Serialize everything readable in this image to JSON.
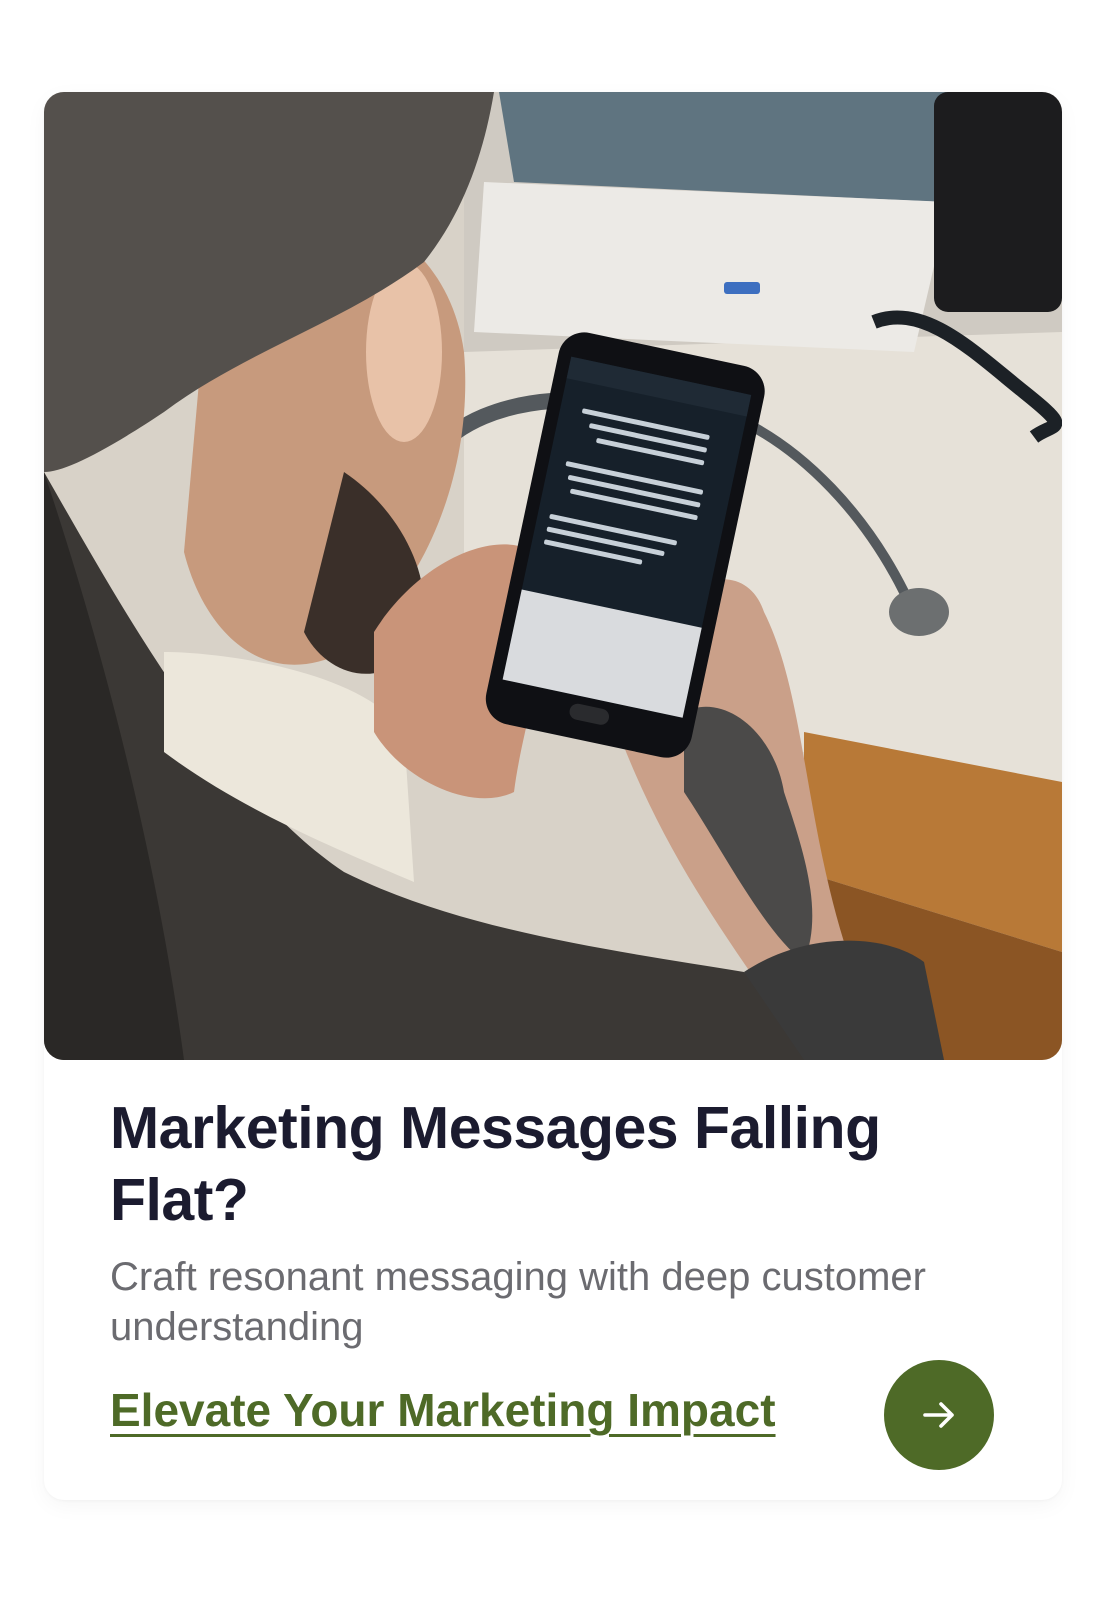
{
  "card": {
    "image_alt": "Person using a smartphone at a desk",
    "title": "Marketing Messages Falling Flat?",
    "subtitle": "Craft resonant messaging with deep customer understanding",
    "cta_label": "Elevate Your Marketing Impact",
    "cta_icon": "arrow-right-icon",
    "accent_color": "#4e6a27"
  }
}
